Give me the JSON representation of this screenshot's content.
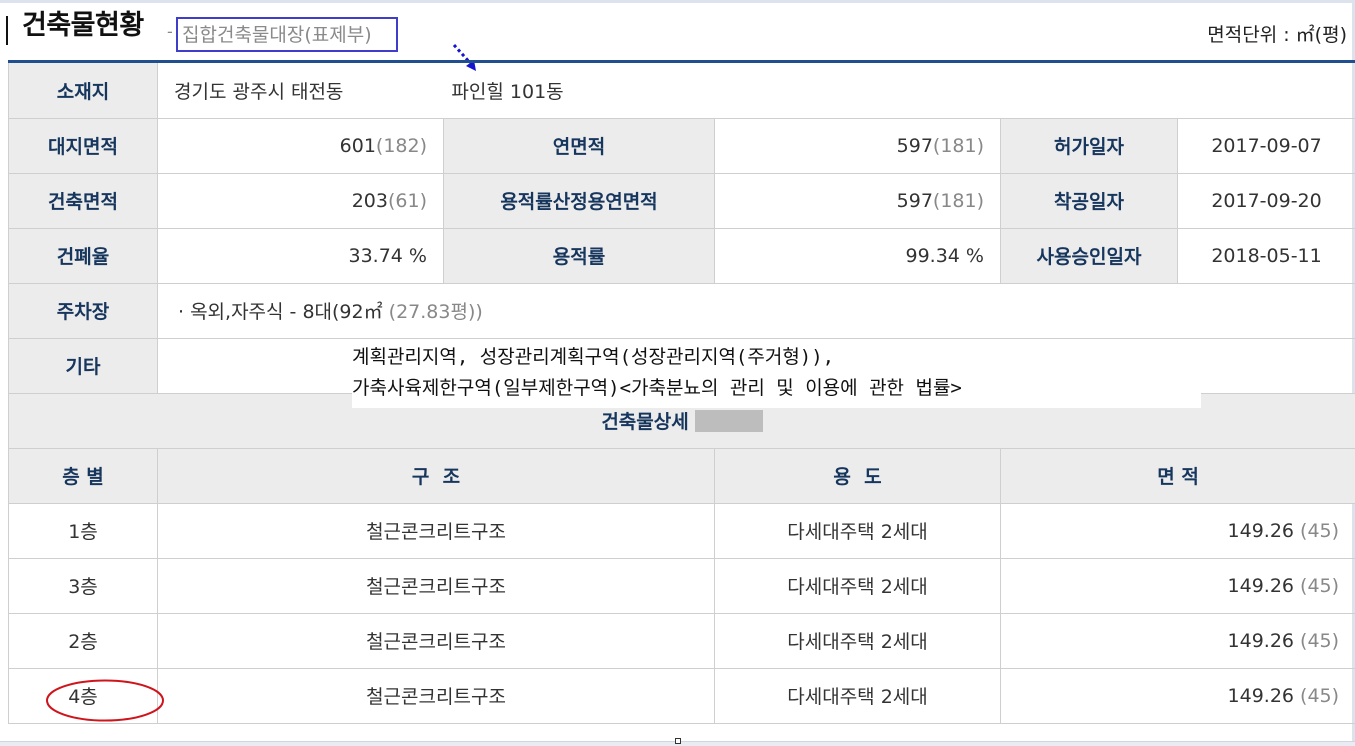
{
  "header": {
    "title": "건축물현황",
    "dash": "-",
    "subtitle": "집합건축물대장(표제부)",
    "unit_label": "면적단위 : ㎡(평)"
  },
  "info": {
    "location_label": "소재지",
    "location_value": "경기도 광주시 태전동",
    "building_name": "파인힐 101동",
    "land_area_label": "대지면적",
    "land_area": "601",
    "land_area_pyeong": "(182)",
    "total_floor_area_label": "연면적",
    "total_floor_area": "597",
    "total_floor_area_pyeong": "(181)",
    "permit_date_label": "허가일자",
    "permit_date": "2017-09-07",
    "building_area_label": "건축면적",
    "building_area": "203",
    "building_area_pyeong": "(61)",
    "far_floor_area_label": "용적률산정용연면적",
    "far_floor_area": "597",
    "far_floor_area_pyeong": "(181)",
    "start_date_label": "착공일자",
    "start_date": "2017-09-20",
    "coverage_label": "건폐율",
    "coverage": "33.74 %",
    "far_label": "용적률",
    "far": "99.34 %",
    "approval_date_label": "사용승인일자",
    "approval_date": "2018-05-11",
    "parking_label": "주차장",
    "parking_value": "· 옥외,자주식 - 8대(92㎡",
    "parking_pyeong": "(27.83평))",
    "etc_label": "기타",
    "etc_line1": "계획관리지역, 성장관리계획구역(성장관리지역(주거형)),",
    "etc_line2": "가축사육제한구역(일부제한구역)<가축분뇨의 관리 및 이용에 관한 법률>"
  },
  "detail": {
    "section_title": "건축물상세",
    "columns": [
      "층 별",
      "구  조",
      "용  도",
      "면 적"
    ],
    "rows": [
      {
        "floor": "1층",
        "structure": "철근콘크리트구조",
        "use": "다세대주택 2세대",
        "area": "149.26",
        "area_pyeong": "(45)"
      },
      {
        "floor": "3층",
        "structure": "철근콘크리트구조",
        "use": "다세대주택 2세대",
        "area": "149.26",
        "area_pyeong": "(45)"
      },
      {
        "floor": "2층",
        "structure": "철근콘크리트구조",
        "use": "다세대주택 2세대",
        "area": "149.26",
        "area_pyeong": "(45)"
      },
      {
        "floor": "4층",
        "structure": "철근콘크리트구조",
        "use": "다세대주택 2세대",
        "area": "149.26",
        "area_pyeong": "(45)"
      }
    ]
  },
  "colors": {
    "accent_rule": "#1f4f8f",
    "label_text": "#17365d",
    "subtitle_box": "#3e3ec8",
    "annotation_arrow": "#1515d0",
    "annotation_ellipse": "#d0141c"
  }
}
